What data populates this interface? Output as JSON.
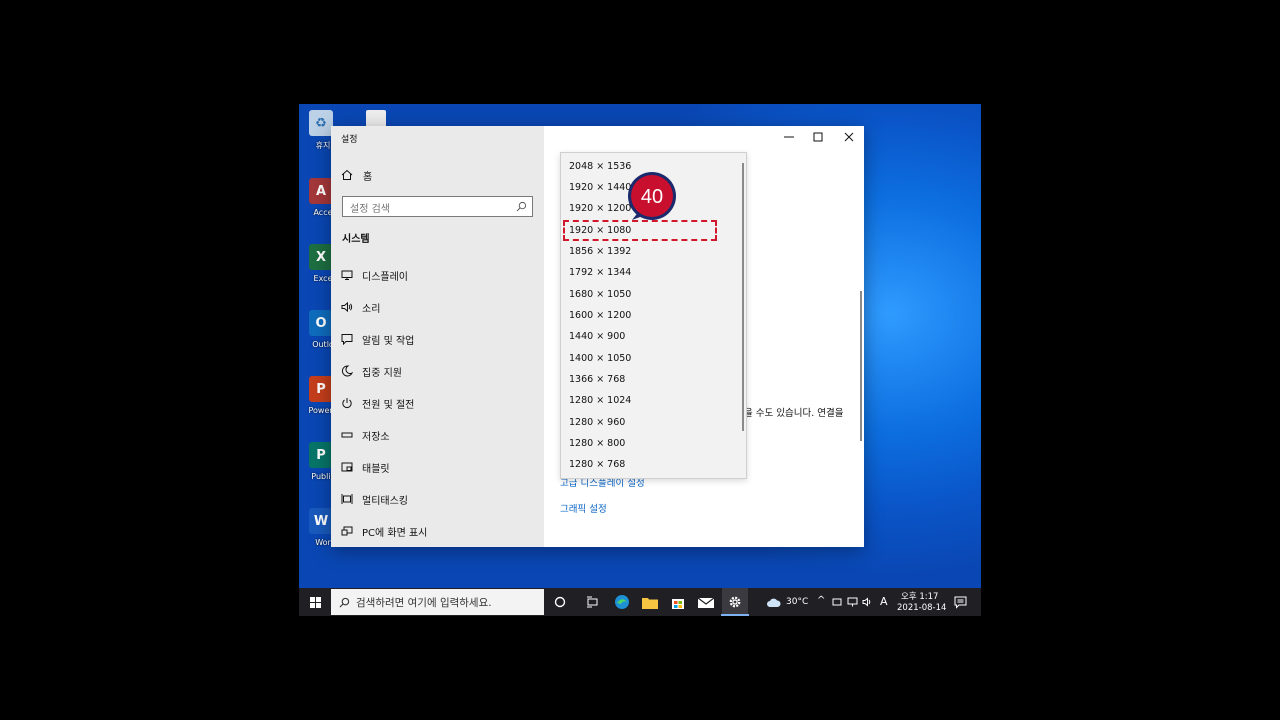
{
  "desktop": {
    "icons": [
      {
        "label": "휴지",
        "color": "#9bb7d4",
        "glyph": "♻"
      },
      {
        "label": "Acce",
        "color": "#a4373a",
        "glyph": "A"
      },
      {
        "label": "Exce",
        "color": "#1d6f42",
        "glyph": "X"
      },
      {
        "label": "Outlo",
        "color": "#0f6cbd",
        "glyph": "O"
      },
      {
        "label": "PowerP",
        "color": "#c43e1c",
        "glyph": "P"
      },
      {
        "label": "Publis",
        "color": "#077568",
        "glyph": "P"
      },
      {
        "label": "Wor",
        "color": "#185abd",
        "glyph": "W"
      }
    ]
  },
  "window": {
    "title": "설정",
    "nav": {
      "home_label": "홈",
      "search_placeholder": "설정 검색",
      "section_title": "시스템",
      "items": [
        {
          "label": "디스플레이",
          "icon": "monitor-icon"
        },
        {
          "label": "소리",
          "icon": "speaker-icon"
        },
        {
          "label": "알림 및 작업",
          "icon": "notification-icon"
        },
        {
          "label": "집중 지원",
          "icon": "moon-icon"
        },
        {
          "label": "전원 및 절전",
          "icon": "power-icon"
        },
        {
          "label": "저장소",
          "icon": "storage-icon"
        },
        {
          "label": "태블릿",
          "icon": "tablet-icon"
        },
        {
          "label": "멀티태스킹",
          "icon": "multitasking-icon"
        },
        {
          "label": "PC에 화면 표시",
          "icon": "project-icon"
        }
      ]
    },
    "main": {
      "partial_text": "을 수도 있습니다. 연결을",
      "advanced_link": "고급 디스플레이 설정",
      "graphics_link": "그래픽 설정"
    },
    "resolution_dropdown": {
      "options": [
        "2048 × 1536",
        "1920 × 1440",
        "1920 × 1200",
        "1920 × 1080",
        "1856 × 1392",
        "1792 × 1344",
        "1680 × 1050",
        "1600 × 1200",
        "1440 × 900",
        "1400 × 1050",
        "1366 × 768",
        "1280 × 1024",
        "1280 × 960",
        "1280 × 800",
        "1280 × 768"
      ],
      "highlighted": "1920 × 1080"
    },
    "step_badge": "40"
  },
  "taskbar": {
    "search_placeholder": "검색하려면 여기에 입력하세요.",
    "weather": "30°C",
    "ime": "A",
    "time_period": "오후 1:17",
    "date": "2021-08-14",
    "notification_count": "1"
  },
  "colors": {
    "accent_link": "#0a64c4",
    "highlight_red": "#d0182a",
    "badge_red": "#c8102e",
    "badge_navy": "#1a2a6c"
  }
}
